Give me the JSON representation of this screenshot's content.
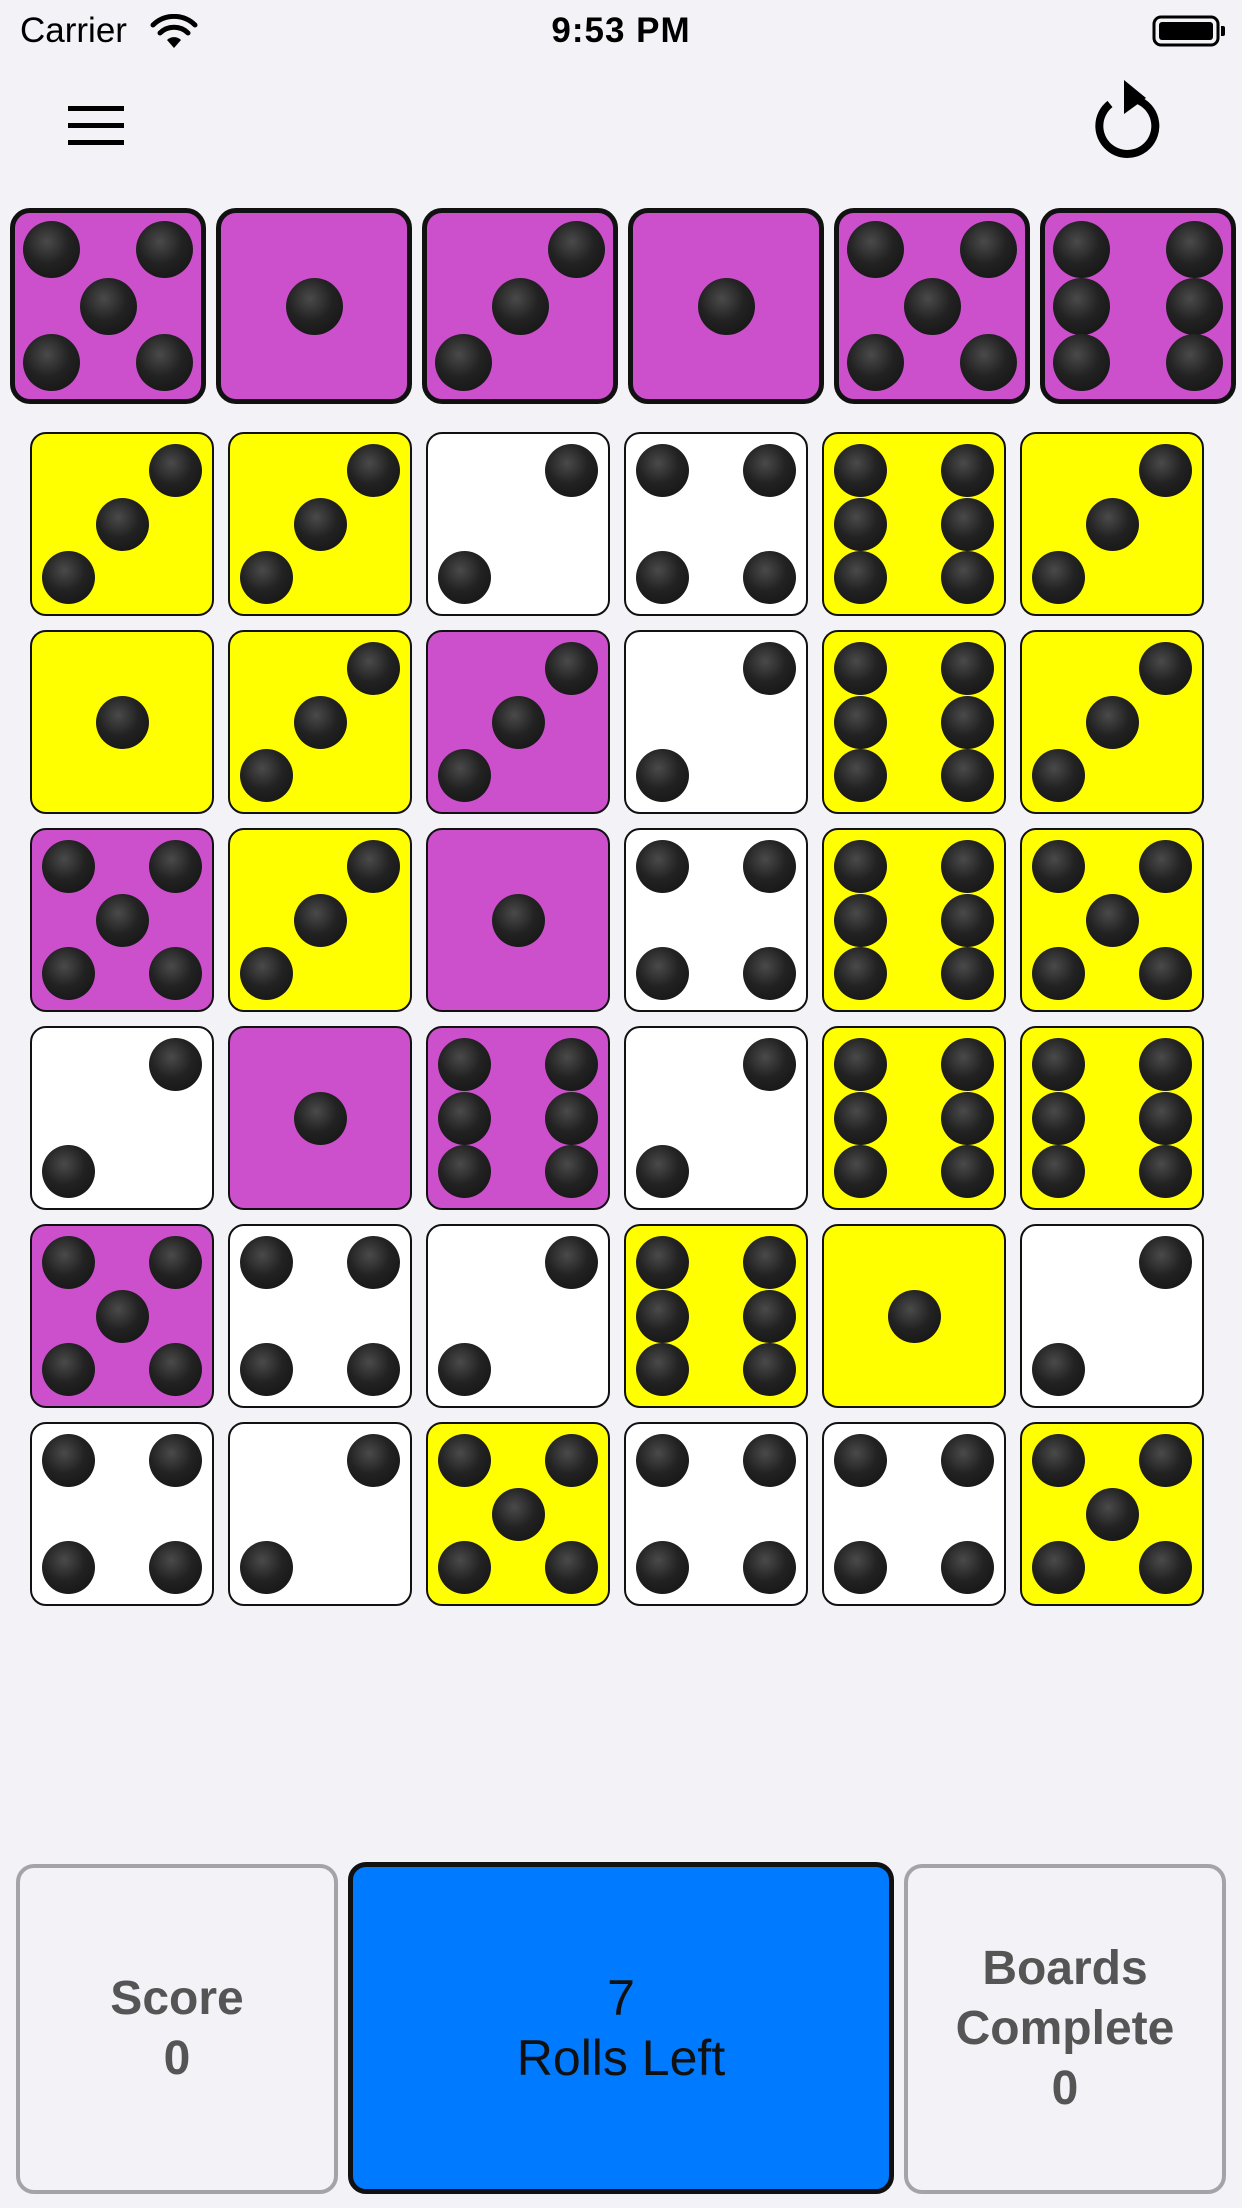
{
  "status_bar": {
    "carrier": "Carrier",
    "time": "9:53 PM",
    "wifi_icon": "wifi-icon",
    "battery_icon": "battery-icon"
  },
  "toolbar": {
    "menu_icon": "hamburger-menu-icon",
    "reset_icon": "reset-arrow-icon"
  },
  "colors": {
    "background": "#f2f2f7",
    "white_die": "#ffffff",
    "yellow_die": "#ffff00",
    "purple_die": "#cc4fcc",
    "roll_button": "#007aff",
    "panel_border": "#a4a4a8"
  },
  "target_dice": [
    {
      "value": 5,
      "color": "purple"
    },
    {
      "value": 1,
      "color": "purple"
    },
    {
      "value": 3,
      "color": "purple"
    },
    {
      "value": 1,
      "color": "purple"
    },
    {
      "value": 5,
      "color": "purple"
    },
    {
      "value": 6,
      "color": "purple"
    }
  ],
  "board": [
    [
      {
        "value": 3,
        "color": "yellow"
      },
      {
        "value": 3,
        "color": "yellow"
      },
      {
        "value": 2,
        "color": "white"
      },
      {
        "value": 4,
        "color": "white"
      },
      {
        "value": 6,
        "color": "yellow"
      },
      {
        "value": 3,
        "color": "yellow"
      }
    ],
    [
      {
        "value": 1,
        "color": "yellow"
      },
      {
        "value": 3,
        "color": "yellow"
      },
      {
        "value": 3,
        "color": "purple"
      },
      {
        "value": 2,
        "color": "white"
      },
      {
        "value": 6,
        "color": "yellow"
      },
      {
        "value": 3,
        "color": "yellow"
      }
    ],
    [
      {
        "value": 5,
        "color": "purple"
      },
      {
        "value": 3,
        "color": "yellow"
      },
      {
        "value": 1,
        "color": "purple"
      },
      {
        "value": 4,
        "color": "white"
      },
      {
        "value": 6,
        "color": "yellow"
      },
      {
        "value": 5,
        "color": "yellow"
      }
    ],
    [
      {
        "value": 2,
        "color": "white"
      },
      {
        "value": 1,
        "color": "purple"
      },
      {
        "value": 6,
        "color": "purple"
      },
      {
        "value": 2,
        "color": "white"
      },
      {
        "value": 6,
        "color": "yellow"
      },
      {
        "value": 6,
        "color": "yellow"
      }
    ],
    [
      {
        "value": 5,
        "color": "purple"
      },
      {
        "value": 4,
        "color": "white"
      },
      {
        "value": 2,
        "color": "white"
      },
      {
        "value": 6,
        "color": "yellow"
      },
      {
        "value": 1,
        "color": "yellow"
      },
      {
        "value": 2,
        "color": "white"
      }
    ],
    [
      {
        "value": 4,
        "color": "white"
      },
      {
        "value": 2,
        "color": "white"
      },
      {
        "value": 5,
        "color": "yellow"
      },
      {
        "value": 4,
        "color": "white"
      },
      {
        "value": 4,
        "color": "white"
      },
      {
        "value": 5,
        "color": "yellow"
      }
    ]
  ],
  "score_panel": {
    "label": "Score",
    "value": "0"
  },
  "roll_button": {
    "value": "7",
    "label": "Rolls Left"
  },
  "boards_panel": {
    "label_line1": "Boards",
    "label_line2": "Complete",
    "value": "0"
  }
}
